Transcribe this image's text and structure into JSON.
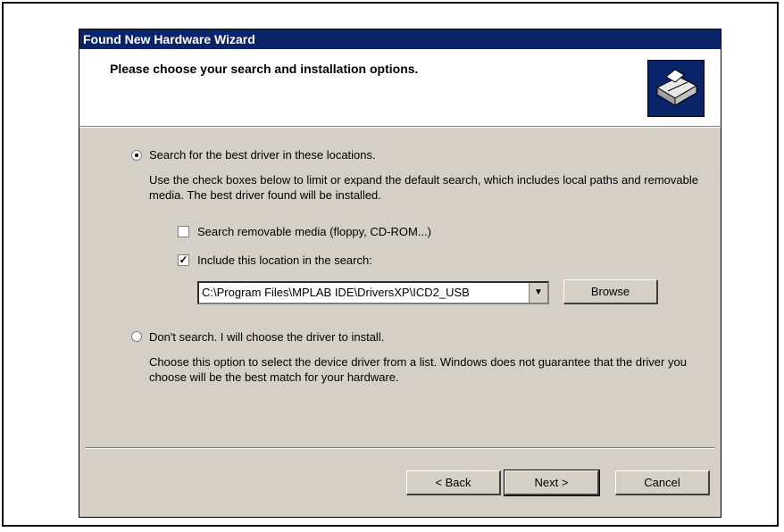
{
  "window": {
    "title": "Found New Hardware Wizard"
  },
  "header": {
    "title": "Please choose your search and installation options.",
    "icon": "hardware-icon"
  },
  "options": {
    "search": {
      "label": "Search for the best driver in these locations.",
      "description": "Use the check boxes below to limit or expand the default search, which includes local paths and removable media. The best driver found will be installed.",
      "selected": true
    },
    "removable": {
      "label": "Search removable media (floppy, CD-ROM...)",
      "checked": false
    },
    "include_location": {
      "label": "Include this location in the search:",
      "checked": true
    },
    "location_value": "C:\\Program Files\\MPLAB IDE\\DriversXP\\ICD2_USB",
    "browse_label": "Browse",
    "dont_search": {
      "label": "Don't search. I will choose the driver to install.",
      "description": "Choose this option to select the device driver from a list.  Windows does not guarantee that the driver you choose will be the best match for your hardware.",
      "selected": false
    }
  },
  "buttons": {
    "back": "< Back",
    "next": "Next >",
    "cancel": "Cancel"
  }
}
